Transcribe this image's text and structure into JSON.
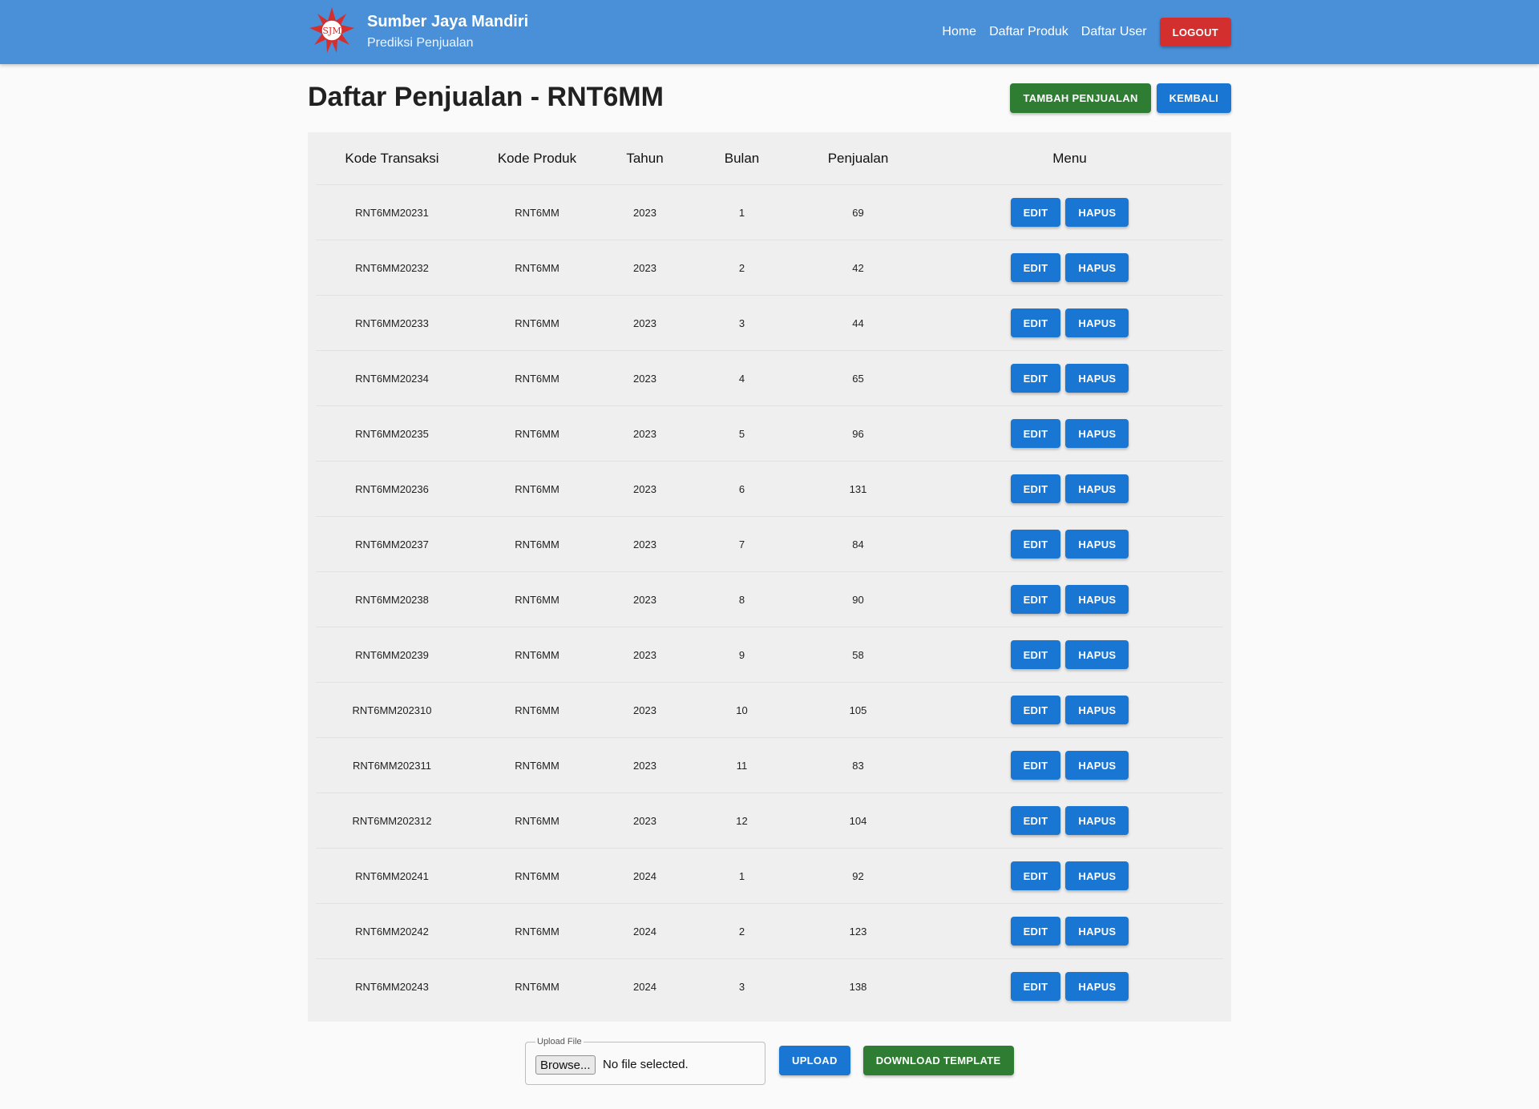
{
  "navbar": {
    "logo_text": "SJM",
    "brand_name": "Sumber Jaya Mandiri",
    "brand_subtitle": "Prediksi Penjualan",
    "links": [
      "Home",
      "Daftar Produk",
      "Daftar User"
    ],
    "logout_label": "LOGOUT"
  },
  "page": {
    "title": "Daftar Penjualan - RNT6MM",
    "add_label": "TAMBAH PENJUALAN",
    "back_label": "KEMBALI"
  },
  "table": {
    "headers": [
      "Kode Transaksi",
      "Kode Produk",
      "Tahun",
      "Bulan",
      "Penjualan",
      "Menu"
    ],
    "edit_label": "EDIT",
    "delete_label": "HAPUS",
    "rows": [
      [
        "RNT6MM20231",
        "RNT6MM",
        "2023",
        "1",
        "69"
      ],
      [
        "RNT6MM20232",
        "RNT6MM",
        "2023",
        "2",
        "42"
      ],
      [
        "RNT6MM20233",
        "RNT6MM",
        "2023",
        "3",
        "44"
      ],
      [
        "RNT6MM20234",
        "RNT6MM",
        "2023",
        "4",
        "65"
      ],
      [
        "RNT6MM20235",
        "RNT6MM",
        "2023",
        "5",
        "96"
      ],
      [
        "RNT6MM20236",
        "RNT6MM",
        "2023",
        "6",
        "131"
      ],
      [
        "RNT6MM20237",
        "RNT6MM",
        "2023",
        "7",
        "84"
      ],
      [
        "RNT6MM20238",
        "RNT6MM",
        "2023",
        "8",
        "90"
      ],
      [
        "RNT6MM20239",
        "RNT6MM",
        "2023",
        "9",
        "58"
      ],
      [
        "RNT6MM202310",
        "RNT6MM",
        "2023",
        "10",
        "105"
      ],
      [
        "RNT6MM202311",
        "RNT6MM",
        "2023",
        "11",
        "83"
      ],
      [
        "RNT6MM202312",
        "RNT6MM",
        "2023",
        "12",
        "104"
      ],
      [
        "RNT6MM20241",
        "RNT6MM",
        "2024",
        "1",
        "92"
      ],
      [
        "RNT6MM20242",
        "RNT6MM",
        "2024",
        "2",
        "123"
      ],
      [
        "RNT6MM20243",
        "RNT6MM",
        "2024",
        "3",
        "138"
      ]
    ]
  },
  "upload": {
    "legend": "Upload File",
    "browse_label": "Browse...",
    "no_file_text": "No file selected.",
    "upload_label": "UPLOAD",
    "download_label": "DOWNLOAD TEMPLATE"
  },
  "colors": {
    "navbar": "#4a90d9",
    "primary": "#1976d2",
    "success": "#2e7d32",
    "danger": "#d32f2f"
  }
}
